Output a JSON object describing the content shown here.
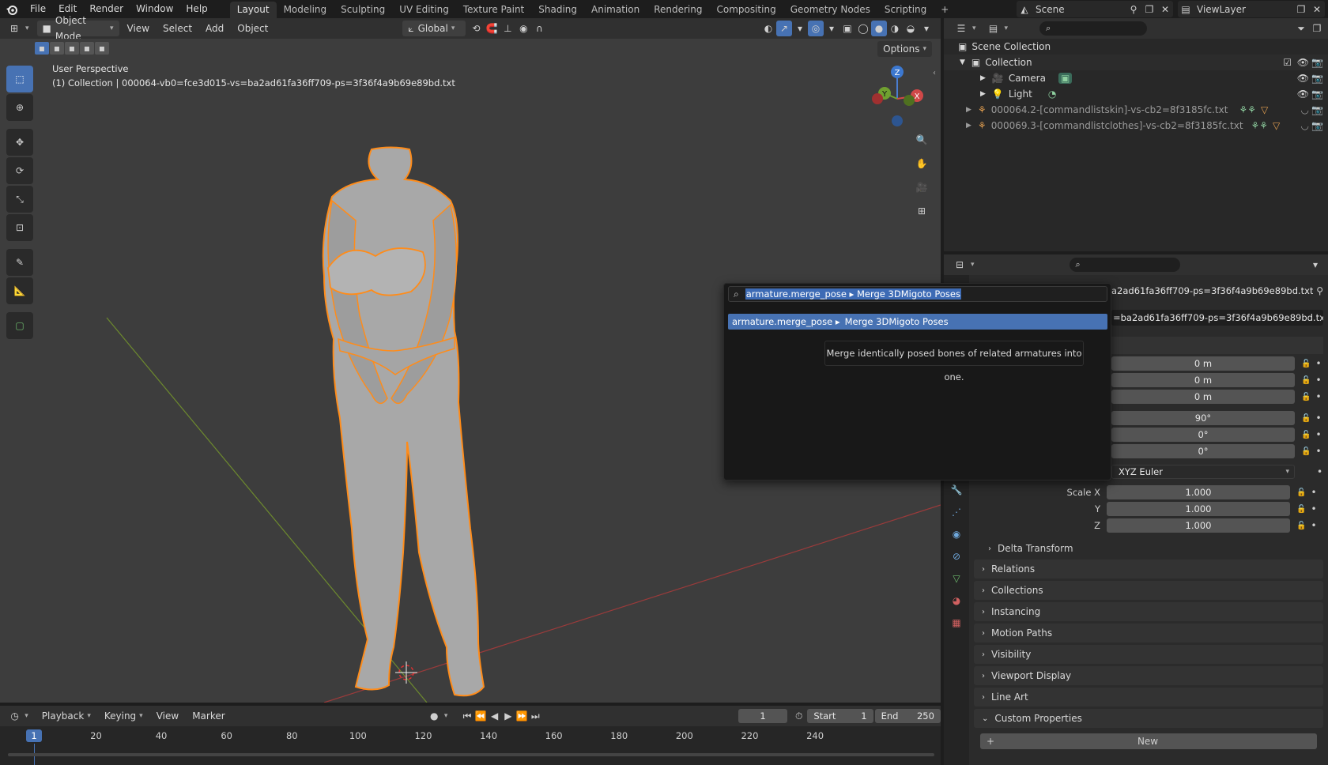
{
  "topbar": {
    "menus": [
      "File",
      "Edit",
      "Render",
      "Window",
      "Help"
    ],
    "workspaces": [
      "Layout",
      "Modeling",
      "Sculpting",
      "UV Editing",
      "Texture Paint",
      "Shading",
      "Animation",
      "Rendering",
      "Compositing",
      "Geometry Nodes",
      "Scripting"
    ],
    "active_workspace": "Layout",
    "add_tab": "+",
    "scene_label": "Scene",
    "view_layer_label": "ViewLayer"
  },
  "viewport_header": {
    "mode": "Object Mode",
    "menus": [
      "View",
      "Select",
      "Add",
      "Object"
    ],
    "orientation": "Global",
    "options_label": "Options"
  },
  "viewport": {
    "perspective_label": "User Perspective",
    "collection_label": "(1) Collection | 000064-vb0=fce3d015-vs=ba2ad61fa36ff709-ps=3f36f4a9b69e89bd.txt",
    "gizmo": {
      "z": "Z",
      "y": "Y",
      "x": "X"
    }
  },
  "search": {
    "query": "armature.merge_pose ▸ Merge 3DMigoto Poses",
    "result_id": "armature.merge_pose ▸",
    "result_name": "Merge 3DMigoto Poses",
    "tooltip": "Merge identically posed bones of related armatures into one."
  },
  "outliner": {
    "root": "Scene Collection",
    "collection": "Collection",
    "items": [
      {
        "name": "Camera"
      },
      {
        "name": "Light"
      },
      {
        "name": "000064.2-[commandlistskin]-vs-cb2=8f3185fc.txt"
      },
      {
        "name": "000069.3-[commandlistclothes]-vs-cb2=8f3185fc.txt"
      }
    ]
  },
  "properties": {
    "object_name_partial": "a2ad61fa36ff709-ps=3f36f4a9b69e89bd.txt",
    "data_name_partial": "=ba2ad61fa36ff709-ps=3f36f4a9b69e89bd.txt",
    "location": [
      "0 m",
      "0 m",
      "0 m"
    ],
    "rotation": [
      "90°",
      "0°",
      "0°"
    ],
    "rotation_mode": "XYZ Euler",
    "scale_x_label": "Scale X",
    "scale_y_label": "Y",
    "scale_z_label": "Z",
    "scale": [
      "1.000",
      "1.000",
      "1.000"
    ],
    "delta_transform": "Delta Transform",
    "panels": [
      "Relations",
      "Collections",
      "Instancing",
      "Motion Paths",
      "Visibility",
      "Viewport Display",
      "Line Art",
      "Custom Properties"
    ],
    "new_button": "New"
  },
  "timeline": {
    "menus": [
      "Playback",
      "Keying",
      "View",
      "Marker"
    ],
    "current_frame": "1",
    "start_label": "Start",
    "start_value": "1",
    "end_label": "End",
    "end_value": "250",
    "ticks": [
      "1",
      "20",
      "40",
      "60",
      "80",
      "100",
      "120",
      "140",
      "160",
      "180",
      "200",
      "220",
      "240"
    ]
  },
  "colors": {
    "accent": "#4772b3",
    "selection": "#ff8c1a",
    "viewport_bg": "#3d3d3d"
  }
}
